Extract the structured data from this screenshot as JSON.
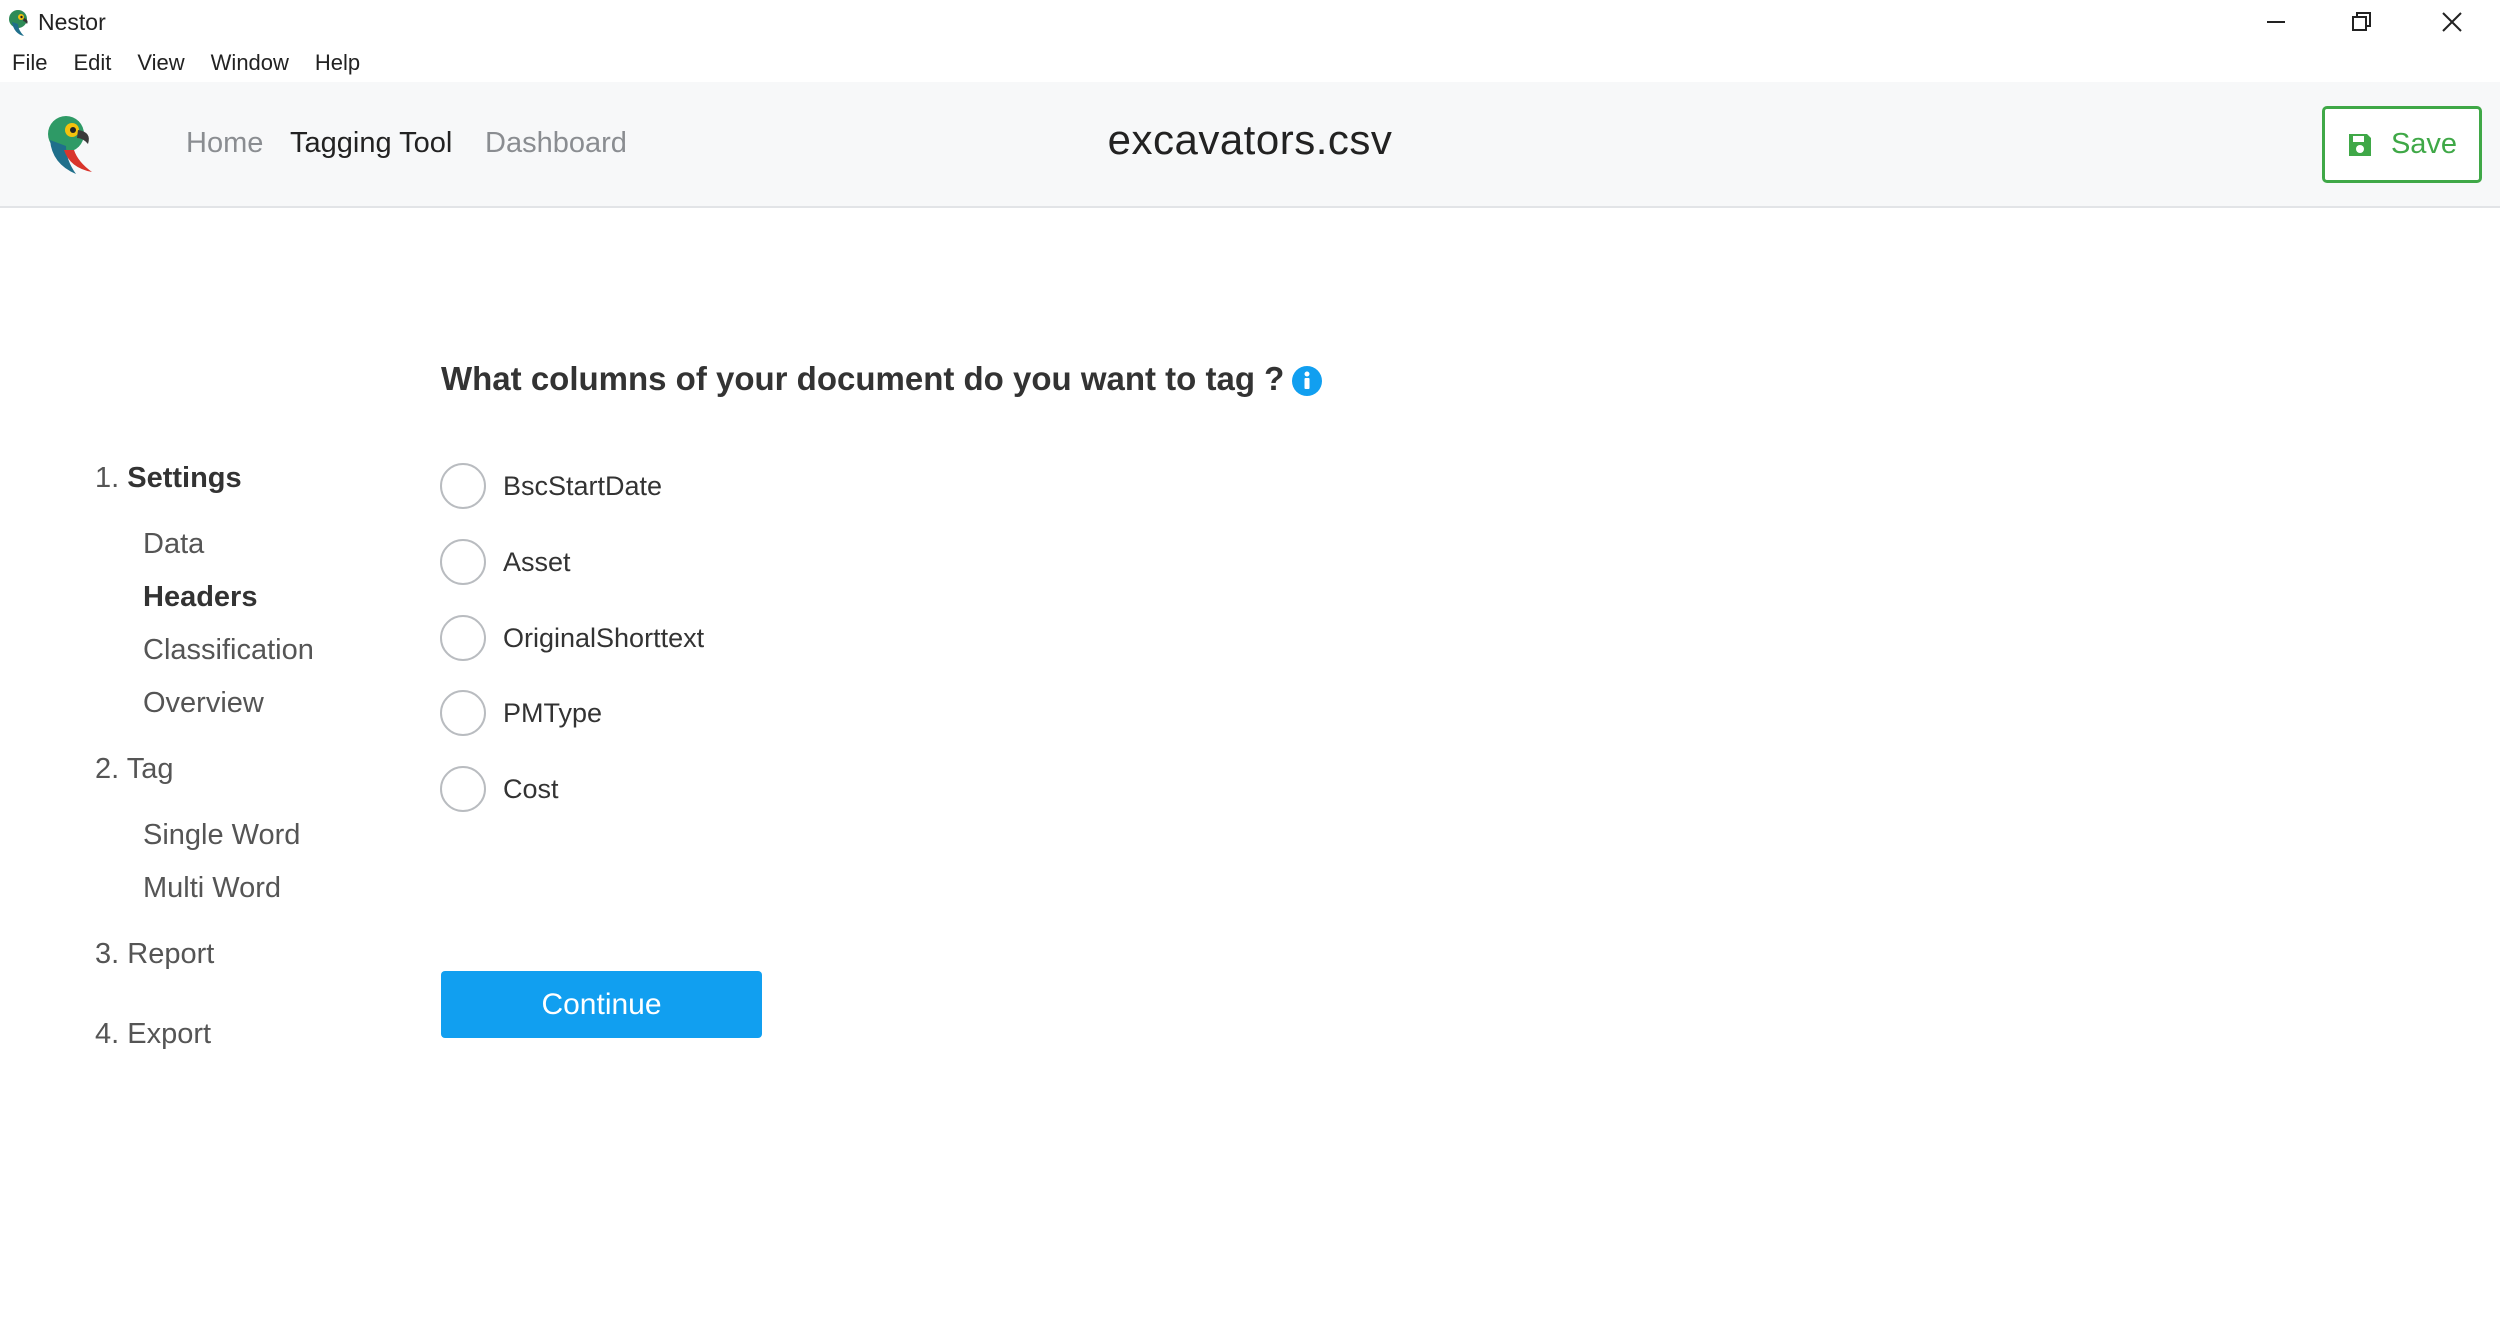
{
  "window": {
    "title": "Nestor",
    "controls": [
      "minimize-icon",
      "restore-icon",
      "close-icon"
    ]
  },
  "menu": [
    "File",
    "Edit",
    "View",
    "Window",
    "Help"
  ],
  "header": {
    "nav": {
      "home": "Home",
      "tagging_tool": "Tagging Tool",
      "dashboard": "Dashboard"
    },
    "filename": "excavators.csv",
    "save_label": "Save"
  },
  "sidebar": {
    "step1": {
      "num": "1.",
      "label": "Settings"
    },
    "step1_items": [
      "Data",
      "Headers",
      "Classification",
      "Overview"
    ],
    "step2": {
      "num": "2.",
      "label": "Tag"
    },
    "step2_items": [
      "Single Word",
      "Multi Word"
    ],
    "step3": {
      "num": "3.",
      "label": "Report"
    },
    "step4": {
      "num": "4.",
      "label": "Export"
    }
  },
  "main": {
    "question": "What columns of your document do you want to tag ?",
    "options": [
      "BscStartDate",
      "Asset",
      "OriginalShorttext",
      "PMType",
      "Cost"
    ],
    "continue_label": "Continue"
  },
  "colors": {
    "accent_blue": "#119ff0",
    "save_green": "#3fa847",
    "header_bg": "#f7f8f9"
  }
}
